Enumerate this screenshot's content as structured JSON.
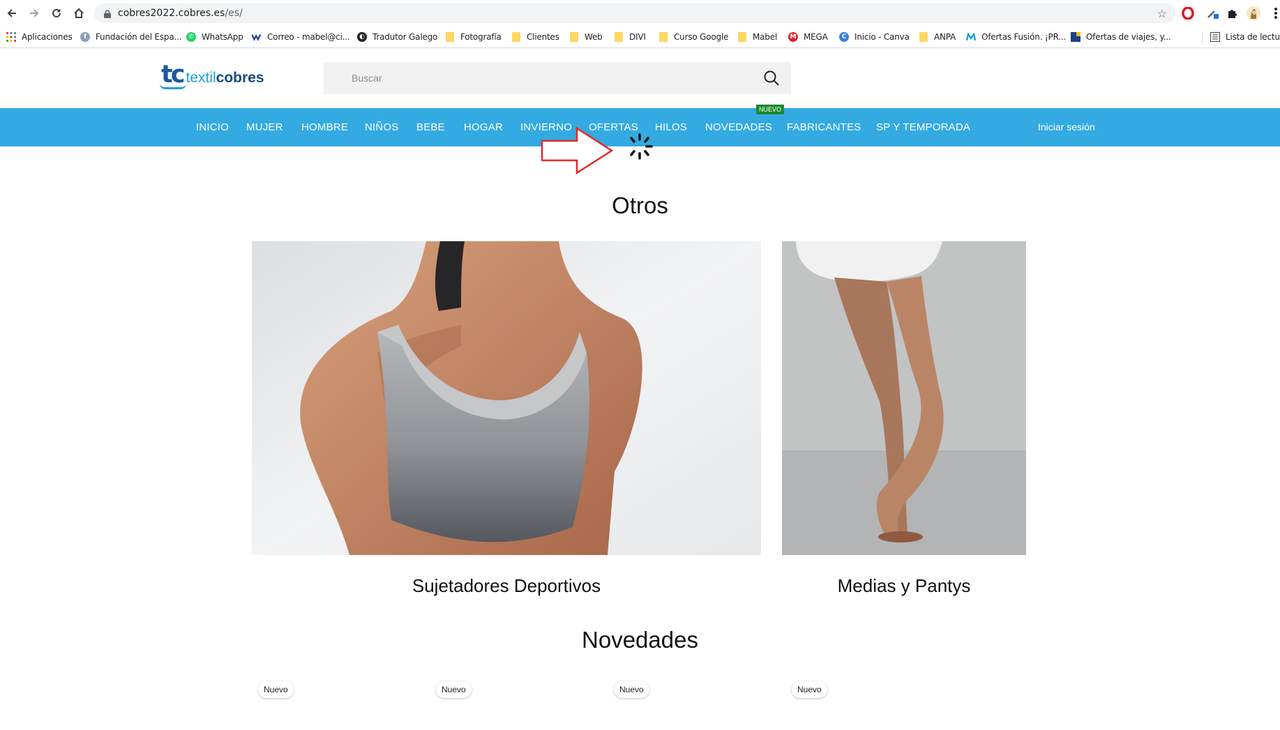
{
  "browser": {
    "url_host": "cobres2022.cobres.es",
    "url_path": "/es/",
    "bookmarks": [
      {
        "label": "Aplicaciones"
      },
      {
        "label": "Fundación del Espa..."
      },
      {
        "label": "WhatsApp"
      },
      {
        "label": "Correo - mabel@ci..."
      },
      {
        "label": "Tradutor Galego"
      },
      {
        "label": "Fotografía"
      },
      {
        "label": "Clientes"
      },
      {
        "label": "Web"
      },
      {
        "label": "DIVI"
      },
      {
        "label": "Curso Google"
      },
      {
        "label": "Mabel"
      },
      {
        "label": "MEGA"
      },
      {
        "label": "Inicio - Canva"
      },
      {
        "label": "ANPA"
      },
      {
        "label": "Ofertas Fusión. ¡PR..."
      },
      {
        "label": "Ofertas de viajes, y..."
      },
      {
        "label": "Lista de lectura"
      }
    ]
  },
  "site": {
    "logo_mark": "tc",
    "logo_text_1": "textil",
    "logo_text_2": "cobres",
    "search_placeholder": "Buscar",
    "nav": [
      {
        "label": "INICIO"
      },
      {
        "label": "MUJER"
      },
      {
        "label": "HOMBRE"
      },
      {
        "label": "NIÑOS"
      },
      {
        "label": "BEBE"
      },
      {
        "label": "HOGAR"
      },
      {
        "label": "INVIERNO"
      },
      {
        "label": "OFERTAS"
      },
      {
        "label": "HILOS"
      },
      {
        "label": "NOVEDADES"
      },
      {
        "label": "FABRICANTES"
      },
      {
        "label": "SP Y TEMPORADA"
      }
    ],
    "nav_badge": "NUEVO",
    "login_label": "Iniciar sesión",
    "accent_color": "#33aae1"
  },
  "sections": {
    "otros_title": "Otros",
    "categories": [
      {
        "label": "Sujetadores Deportivos"
      },
      {
        "label": "Medias y Pantys"
      }
    ],
    "novedades_title": "Novedades",
    "new_badges": [
      "Nuevo",
      "Nuevo",
      "Nuevo",
      "Nuevo"
    ]
  }
}
